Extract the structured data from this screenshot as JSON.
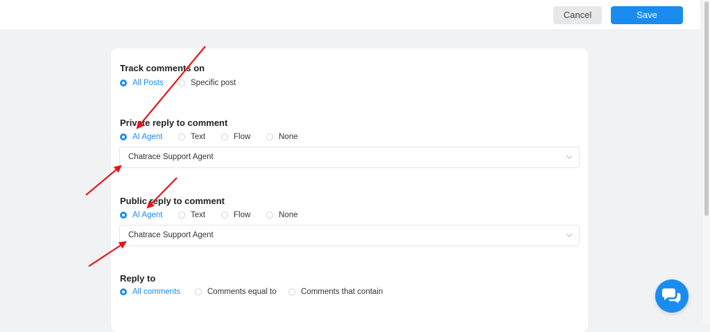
{
  "toolbar": {
    "cancel_label": "Cancel",
    "save_label": "Save"
  },
  "sections": {
    "track": {
      "title": "Track comments on",
      "options": [
        "All Posts",
        "Specific post"
      ],
      "selected": "All Posts"
    },
    "private_reply": {
      "title": "Private reply to comment",
      "options": [
        "AI Agent",
        "Text",
        "Flow",
        "None"
      ],
      "selected": "AI Agent",
      "dropdown_value": "Chatrace Support Agent"
    },
    "public_reply": {
      "title": "Public reply to comment",
      "options": [
        "AI Agent",
        "Text",
        "Flow",
        "None"
      ],
      "selected": "AI Agent",
      "dropdown_value": "Chatrace Support Agent"
    },
    "reply_to": {
      "title": "Reply to",
      "options": [
        "All comments",
        "Comments equal to",
        "Comments that contain"
      ],
      "selected": "All comments"
    }
  },
  "colors": {
    "accent": "#1a8cf0",
    "annotation": "#e8141b",
    "background": "#f1f2f4"
  },
  "icons": {
    "chat_button": "chat-bubbles-icon",
    "dropdown": "chevron-down-icon"
  }
}
